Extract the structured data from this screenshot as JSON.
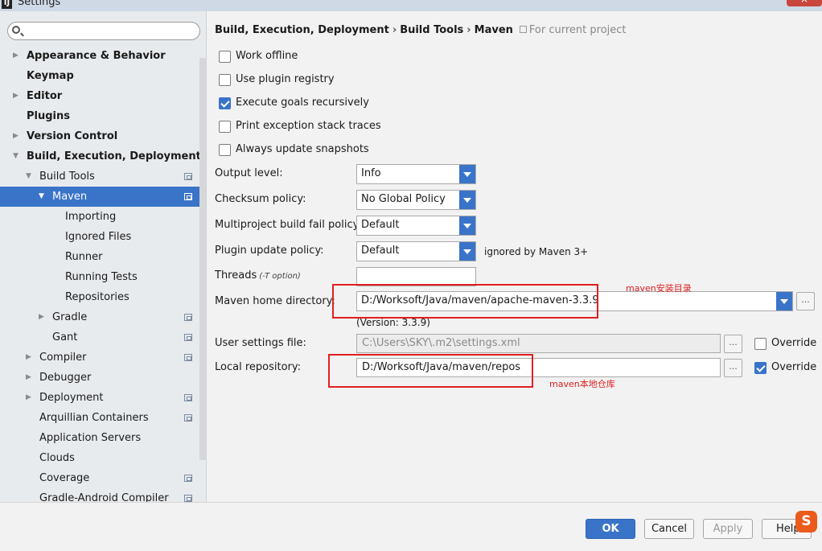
{
  "window": {
    "title": "Settings",
    "app_icon_text": "IJ"
  },
  "sidebar": {
    "search_placeholder": "",
    "items": [
      {
        "label": "Appearance & Behavior",
        "arrow": "▶"
      },
      {
        "label": "Keymap",
        "arrow": ""
      },
      {
        "label": "Editor",
        "arrow": "▶"
      },
      {
        "label": "Plugins",
        "arrow": ""
      },
      {
        "label": "Version Control",
        "arrow": "▶"
      },
      {
        "label": "Build, Execution, Deployment",
        "arrow": "▼"
      },
      {
        "label": "Build Tools",
        "arrow": "▼"
      },
      {
        "label": "Maven",
        "arrow": "▼"
      },
      {
        "label": "Importing",
        "arrow": ""
      },
      {
        "label": "Ignored Files",
        "arrow": ""
      },
      {
        "label": "Runner",
        "arrow": ""
      },
      {
        "label": "Running Tests",
        "arrow": ""
      },
      {
        "label": "Repositories",
        "arrow": ""
      },
      {
        "label": "Gradle",
        "arrow": "▶"
      },
      {
        "label": "Gant",
        "arrow": ""
      },
      {
        "label": "Compiler",
        "arrow": "▶"
      },
      {
        "label": "Debugger",
        "arrow": "▶"
      },
      {
        "label": "Deployment",
        "arrow": "▶"
      },
      {
        "label": "Arquillian Containers",
        "arrow": ""
      },
      {
        "label": "Application Servers",
        "arrow": ""
      },
      {
        "label": "Clouds",
        "arrow": ""
      },
      {
        "label": "Coverage",
        "arrow": ""
      },
      {
        "label": "Gradle-Android Compiler",
        "arrow": ""
      }
    ]
  },
  "breadcrumb": {
    "part1": "Build, Execution, Deployment",
    "sep": "›",
    "part2": "Build Tools",
    "part3": "Maven",
    "scope": "For current project"
  },
  "checkboxes": [
    {
      "label": "Work offline",
      "checked": false
    },
    {
      "label": "Use plugin registry",
      "checked": false
    },
    {
      "label": "Execute goals recursively",
      "checked": true
    },
    {
      "label": "Print exception stack traces",
      "checked": false
    },
    {
      "label": "Always update snapshots",
      "checked": false
    }
  ],
  "form": {
    "output_level_label": "Output level:",
    "output_level_value": "Info",
    "checksum_label": "Checksum policy:",
    "checksum_value": "No Global Policy",
    "multiproject_label": "Multiproject build fail policy:",
    "multiproject_value": "Default",
    "plugin_update_label": "Plugin update policy:",
    "plugin_update_value": "Default",
    "plugin_update_note": "ignored by Maven 3+",
    "threads_label": "Threads",
    "threads_hint": "(-T option)",
    "threads_value": "",
    "maven_home_label": "Maven home directory:",
    "maven_home_value": "D:/Worksoft/Java/maven/apache-maven-3.3.9",
    "maven_version": "(Version: 3.3.9)",
    "user_settings_label": "User settings file:",
    "user_settings_value": "C:\\Users\\SKY\\.m2\\settings.xml",
    "user_settings_override": "Override",
    "user_settings_override_checked": false,
    "local_repo_label": "Local repository:",
    "local_repo_value": "D:/Worksoft/Java/maven/repos",
    "local_repo_override": "Override",
    "local_repo_override_checked": true,
    "browse": "..."
  },
  "annotations": {
    "maven_home_note": "maven安装目录",
    "local_repo_note": "maven本地仓库",
    "color": "#e02020"
  },
  "buttons": {
    "ok": "OK",
    "cancel": "Cancel",
    "apply": "Apply",
    "help": "Help"
  },
  "tray": {
    "sogou_icon_text": "S"
  },
  "colors": {
    "accent": "#3a74c9",
    "sidebar_bg": "#e8ebee",
    "window_bg": "#f2f2f2"
  }
}
